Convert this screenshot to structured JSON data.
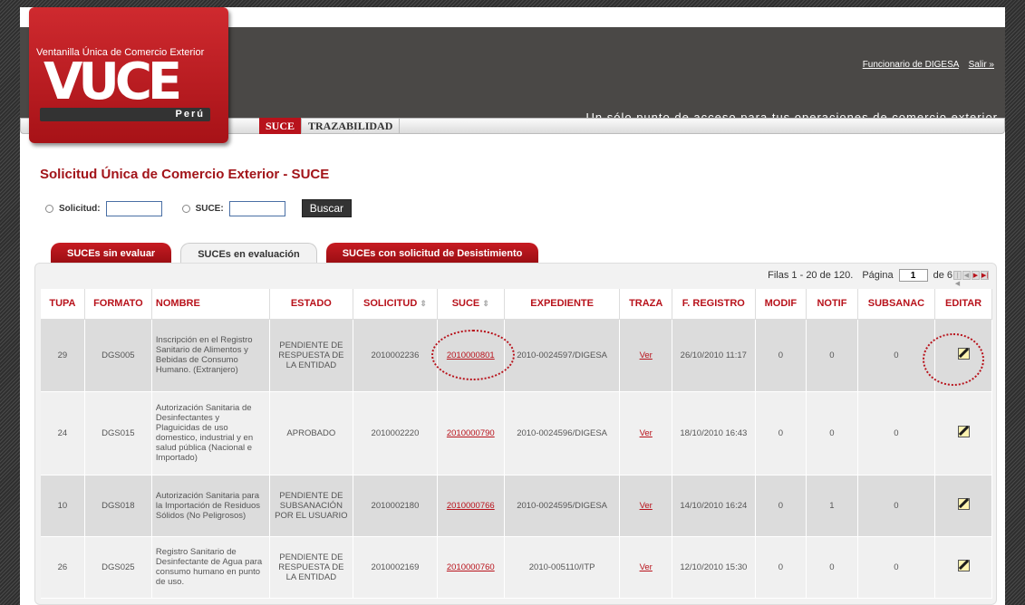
{
  "header": {
    "logo_subtitle": "Ventanilla Única de Comercio Exterior",
    "logo_text": "VUCE",
    "logo_country": "Perú",
    "tagline": "Un sólo punto de acceso para tus operaciones de comercio exterior",
    "user_link": "Funcionario de DIGESA",
    "logout_link": "Salir »"
  },
  "nav": {
    "tabs": [
      {
        "label": "SUCE",
        "active": true
      },
      {
        "label": "TRAZABILIDAD",
        "active": false
      }
    ]
  },
  "page_title": "Solicitud Única de Comercio Exterior - SUCE",
  "search": {
    "solicitud_label": "Solicitud:",
    "suce_label": "SUCE:",
    "button": "Buscar"
  },
  "tabs": [
    {
      "label": "SUCEs sin evaluar",
      "active": false
    },
    {
      "label": "SUCEs en evaluación",
      "active": true
    },
    {
      "label": "SUCEs con solicitud de Desistimiento",
      "active": false
    }
  ],
  "pager": {
    "rows_text": "Filas 1 - 20 de 120.",
    "page_label": "Página",
    "page_value": "1",
    "of_text": "de 6"
  },
  "table": {
    "columns": [
      "TUPA",
      "FORMATO",
      "NOMBRE",
      "ESTADO",
      "SOLICITUD",
      "SUCE",
      "EXPEDIENTE",
      "TRAZA",
      "F. REGISTRO",
      "MODIF",
      "NOTIF",
      "SUBSANAC",
      "EDITAR"
    ],
    "sort_glyph": "⇕",
    "rows": [
      {
        "tupa": "29",
        "formato": "DGS005",
        "nombre": "Inscripción en el Registro Sanitario de Alimentos y Bebidas de Consumo Humano. (Extranjero)",
        "estado": "PENDIENTE DE RESPUESTA DE LA ENTIDAD",
        "solicitud": "2010002236",
        "suce": "2010000801",
        "expediente": "2010-0024597/DIGESA",
        "traza": "Ver",
        "registro": "26/10/2010 11:17",
        "modif": "0",
        "notif": "0",
        "subsanac": "0"
      },
      {
        "tupa": "24",
        "formato": "DGS015",
        "nombre": "Autorización Sanitaria de Desinfectantes y Plaguicidas de uso domestico, industrial y en salud pública (Nacional e Importado)",
        "estado": "APROBADO",
        "solicitud": "2010002220",
        "suce": "2010000790",
        "expediente": "2010-0024596/DIGESA",
        "traza": "Ver",
        "registro": "18/10/2010 16:43",
        "modif": "0",
        "notif": "0",
        "subsanac": "0"
      },
      {
        "tupa": "10",
        "formato": "DGS018",
        "nombre": "Autorización Sanitaria para la Importación de Residuos Sólidos (No Peligrosos)",
        "estado": "PENDIENTE DE SUBSANACIÓN POR EL USUARIO",
        "solicitud": "2010002180",
        "suce": "2010000766",
        "expediente": "2010-0024595/DIGESA",
        "traza": "Ver",
        "registro": "14/10/2010 16:24",
        "modif": "0",
        "notif": "1",
        "subsanac": "0"
      },
      {
        "tupa": "26",
        "formato": "DGS025",
        "nombre": "Registro Sanitario de Desinfectante de Agua para consumo humano en punto de uso.",
        "estado": "PENDIENTE DE RESPUESTA DE LA ENTIDAD",
        "solicitud": "2010002169",
        "suce": "2010000760",
        "expediente": "2010-005110/ITP",
        "traza": "Ver",
        "registro": "12/10/2010 15:30",
        "modif": "0",
        "notif": "0",
        "subsanac": "0"
      }
    ]
  },
  "colors": {
    "brand_red": "#b8121b",
    "header_gray": "#4a4846"
  }
}
